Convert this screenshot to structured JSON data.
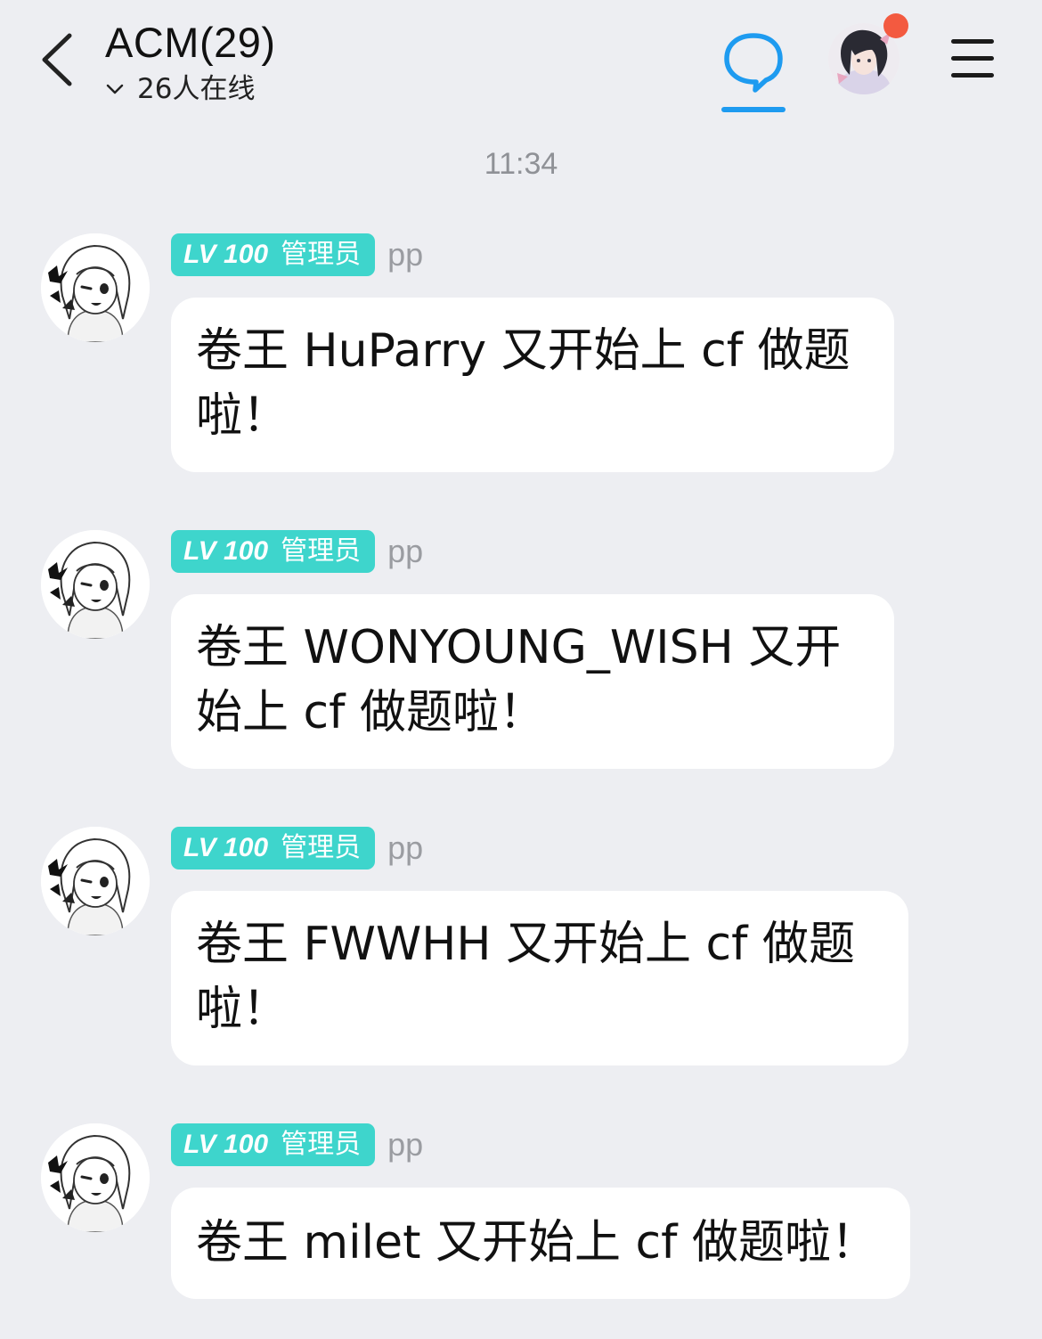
{
  "header": {
    "title": "ACM(29)",
    "online_text": "26人在线",
    "accent_color": "#1E9BF0",
    "notification_color": "#F35A40"
  },
  "timestamp": "11:34",
  "messages": [
    {
      "level": "LV 100",
      "role": "管理员",
      "sender": "pp",
      "text": "卷王 HuParry 又开始上 cf 做题啦！"
    },
    {
      "level": "LV 100",
      "role": "管理员",
      "sender": "pp",
      "text": "卷王 WONYOUNG_WISH 又开始上 cf 做题啦！"
    },
    {
      "level": "LV 100",
      "role": "管理员",
      "sender": "pp",
      "text": "卷王 FWWHH 又开始上 cf 做题啦！"
    },
    {
      "level": "LV 100",
      "role": "管理员",
      "sender": "pp",
      "text": "卷王 milet 又开始上 cf 做题啦！"
    }
  ],
  "colors": {
    "background": "#EDEEF2",
    "badge": "#3ED5CC",
    "bubble": "#FFFFFF",
    "timestamp": "#8F9196"
  }
}
